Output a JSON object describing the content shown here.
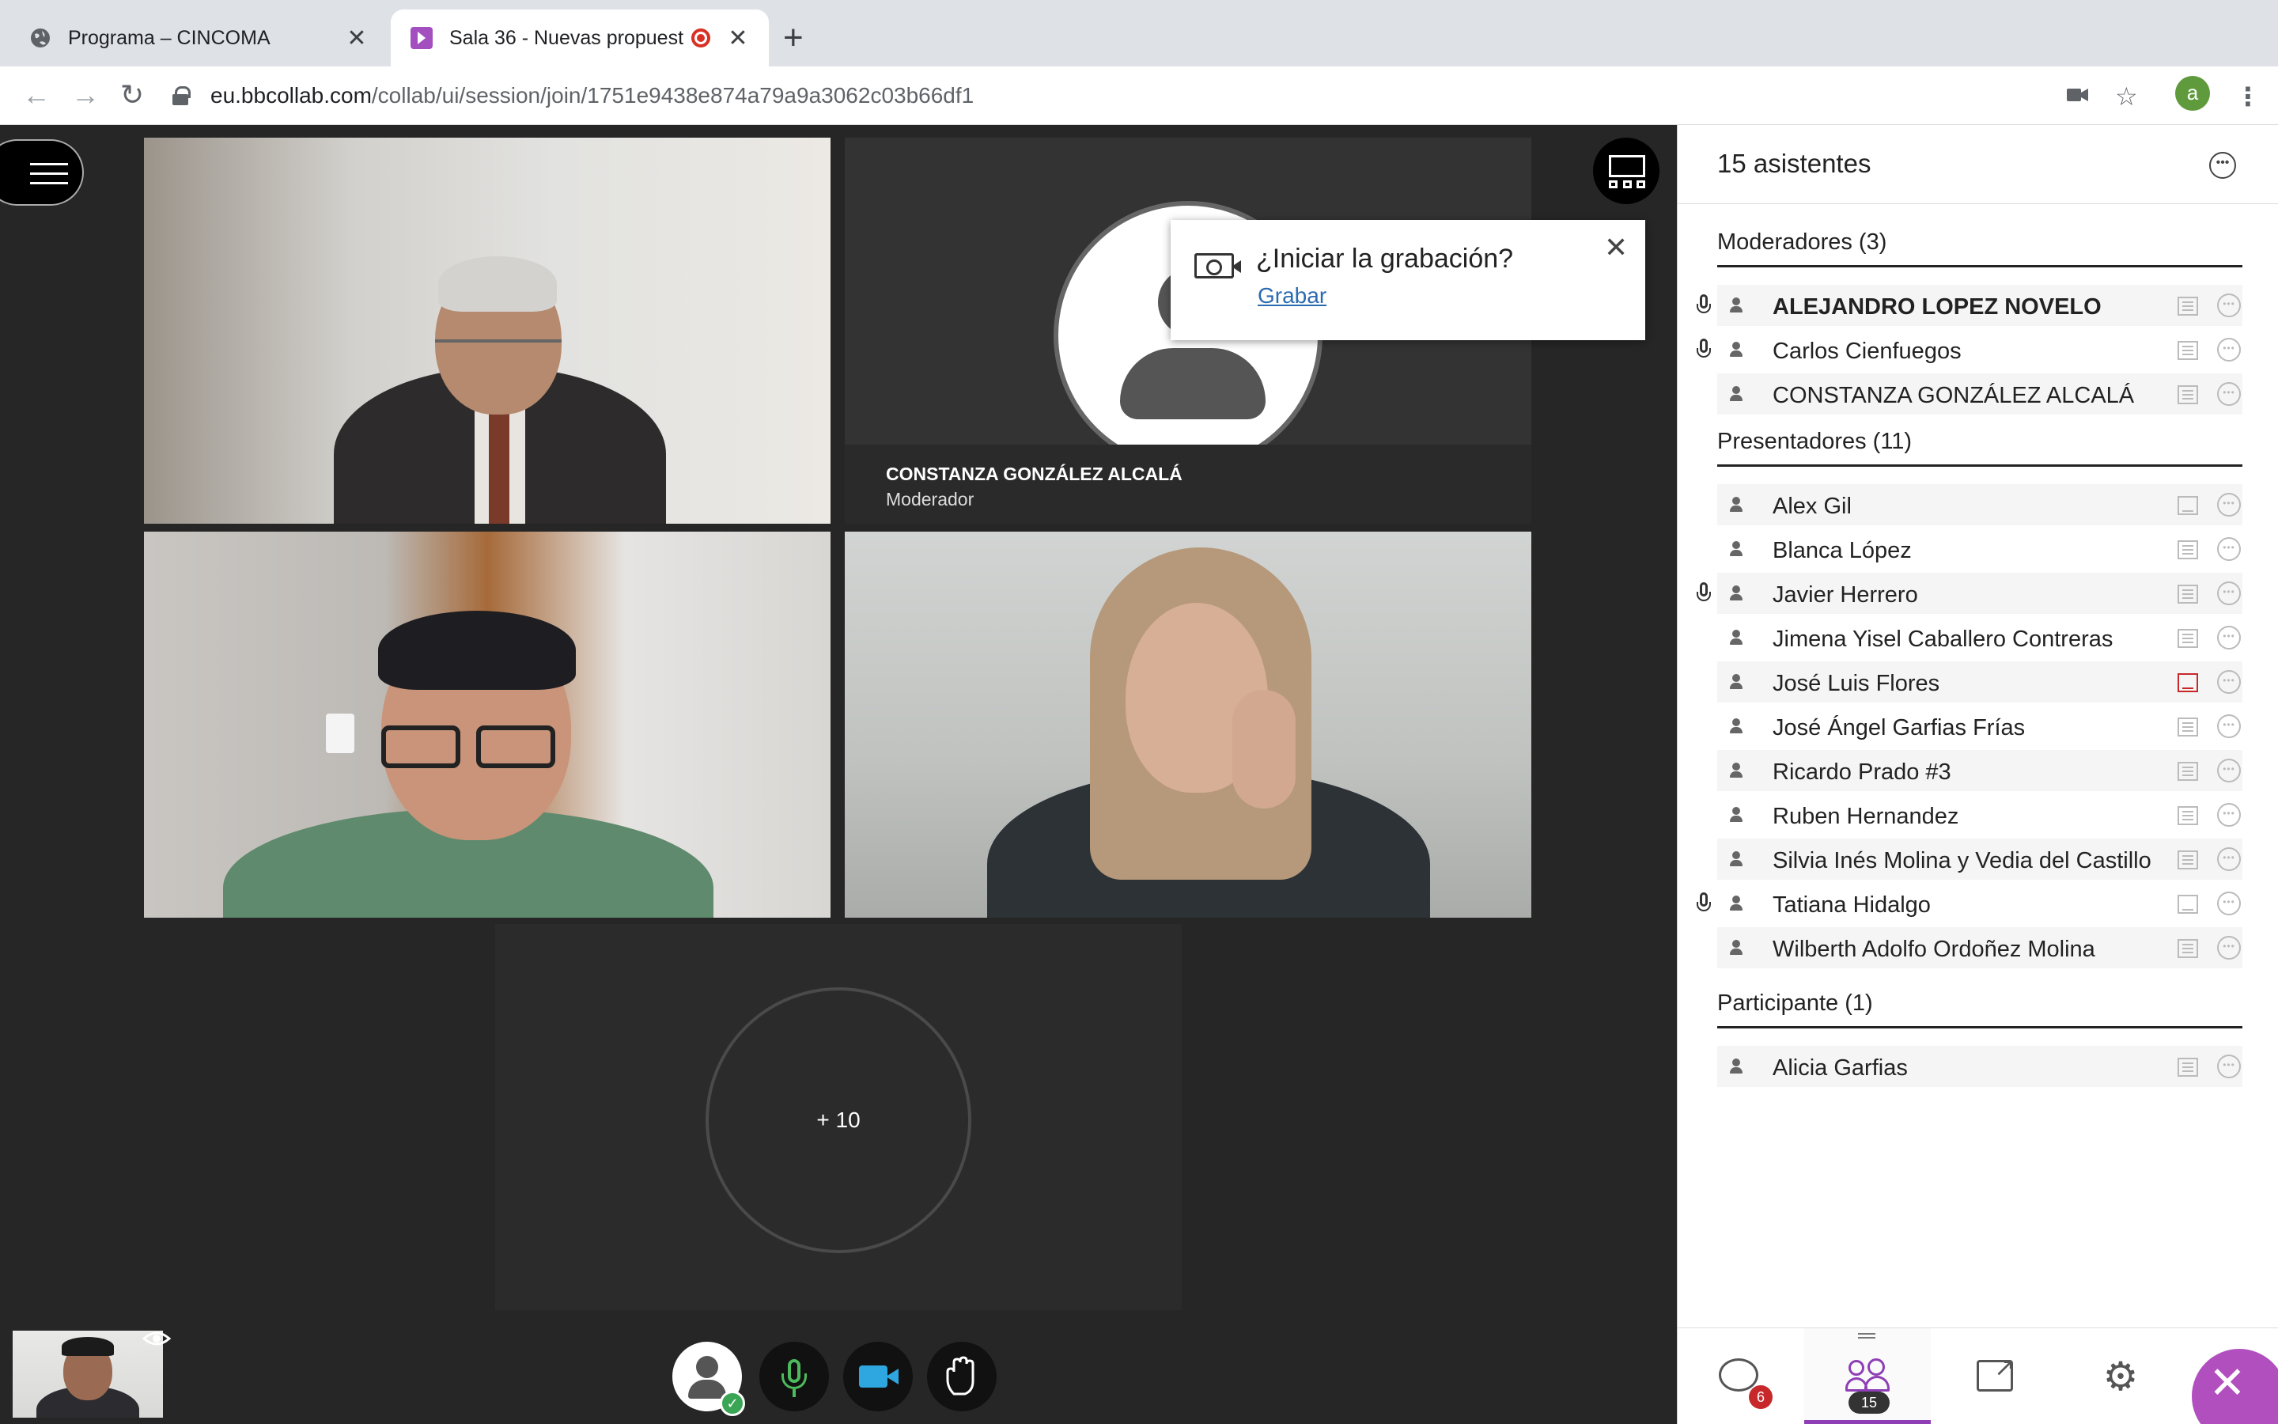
{
  "browser": {
    "tabs": [
      {
        "title": "Programa – CINCOMA",
        "close": "✕"
      },
      {
        "title": "Sala 36 - Nuevas propuest",
        "close": "✕"
      }
    ],
    "new_tab": "+",
    "url_host": "eu.bbcollab.com",
    "url_path": "/collab/ui/session/join/1751e9438e874a79a9a3062c03b66df1",
    "profile_initial": "a"
  },
  "stage": {
    "tile_name": "CONSTANZA GONZÁLEZ ALCALÁ",
    "tile_role": "Moderador",
    "more_count": "+ 10",
    "record_prompt": {
      "question": "¿Iniciar la grabación?",
      "link": "Grabar",
      "close": "✕"
    }
  },
  "panel": {
    "title": "15 asistentes",
    "sections": [
      {
        "title": "Moderadores (3)",
        "people": [
          {
            "name": "ALEJANDRO LOPEZ NOVELO",
            "mic": true,
            "bold": true,
            "caption": "lines"
          },
          {
            "name": "Carlos Cienfuegos",
            "mic": true,
            "bold": false,
            "caption": "lines"
          },
          {
            "name": "CONSTANZA GONZÁLEZ ALCALÁ",
            "mic": false,
            "bold": false,
            "caption": "lines"
          }
        ]
      },
      {
        "title": "Presentadores (11)",
        "people": [
          {
            "name": "Alex Gil",
            "mic": false,
            "caption": "empty"
          },
          {
            "name": "Blanca López",
            "mic": false,
            "caption": "lines"
          },
          {
            "name": "Javier Herrero",
            "mic": true,
            "caption": "lines"
          },
          {
            "name": "Jimena Yisel Caballero Contreras",
            "mic": false,
            "caption": "lines"
          },
          {
            "name": "José Luis Flores",
            "mic": false,
            "caption": "red"
          },
          {
            "name": "José Ángel Garfias Frías",
            "mic": false,
            "caption": "lines"
          },
          {
            "name": "Ricardo Prado #3",
            "mic": false,
            "caption": "lines"
          },
          {
            "name": "Ruben Hernandez",
            "mic": false,
            "caption": "lines"
          },
          {
            "name": "Silvia Inés Molina y Vedia del Castillo",
            "mic": false,
            "caption": "lines"
          },
          {
            "name": "Tatiana Hidalgo",
            "mic": true,
            "caption": "empty"
          },
          {
            "name": "Wilberth Adolfo Ordoñez Molina",
            "mic": false,
            "caption": "lines"
          }
        ]
      },
      {
        "title": "Participante (1)",
        "people": [
          {
            "name": "Alicia Garfias",
            "mic": false,
            "caption": "lines"
          }
        ]
      }
    ],
    "footer": {
      "chat_badge": "6",
      "attendees_badge": "15"
    }
  },
  "colors": {
    "accent": "#8e3fb6",
    "recording": "#d93025",
    "mic_on": "#4cbb5c",
    "camera_on": "#2ea7e0"
  }
}
